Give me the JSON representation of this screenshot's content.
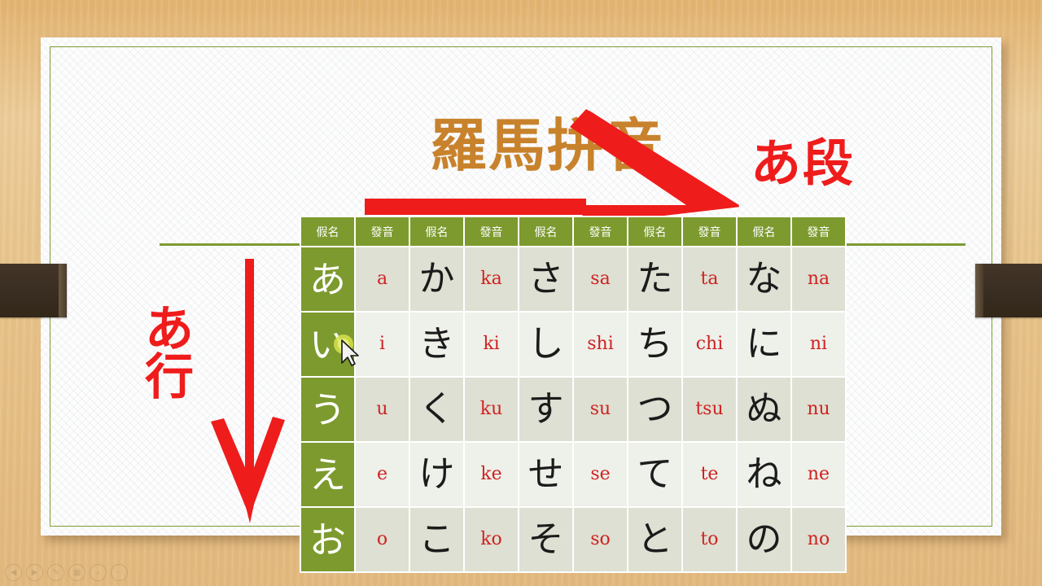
{
  "slide": {
    "romaji_title": "羅馬拼音",
    "column_label": "あ段",
    "row_label_top": "あ",
    "row_label_bottom": "行",
    "accent_green": "#7d9a2e",
    "accent_red": "#ef1c1c",
    "accent_orange": "#c8822c",
    "romaji_text_color": "#cf2222"
  },
  "table": {
    "headers": [
      "假名",
      "發音",
      "假名",
      "發音",
      "假名",
      "發音",
      "假名",
      "發音",
      "假名",
      "發音"
    ],
    "rows": [
      {
        "cells": [
          "あ",
          "a",
          "か",
          "ka",
          "さ",
          "sa",
          "た",
          "ta",
          "な",
          "na"
        ]
      },
      {
        "cells": [
          "い",
          "i",
          "き",
          "ki",
          "し",
          "shi",
          "ち",
          "chi",
          "に",
          "ni"
        ]
      },
      {
        "cells": [
          "う",
          "u",
          "く",
          "ku",
          "す",
          "su",
          "つ",
          "tsu",
          "ぬ",
          "nu"
        ]
      },
      {
        "cells": [
          "え",
          "e",
          "け",
          "ke",
          "せ",
          "se",
          "て",
          "te",
          "ね",
          "ne"
        ]
      },
      {
        "cells": [
          "お",
          "o",
          "こ",
          "ko",
          "そ",
          "so",
          "と",
          "to",
          "の",
          "no"
        ]
      }
    ]
  },
  "presentation_controls": {
    "previous": "◀",
    "next": "▶",
    "pen": "✎",
    "slides": "▦",
    "zoom": "⌕",
    "more": "⋯"
  }
}
